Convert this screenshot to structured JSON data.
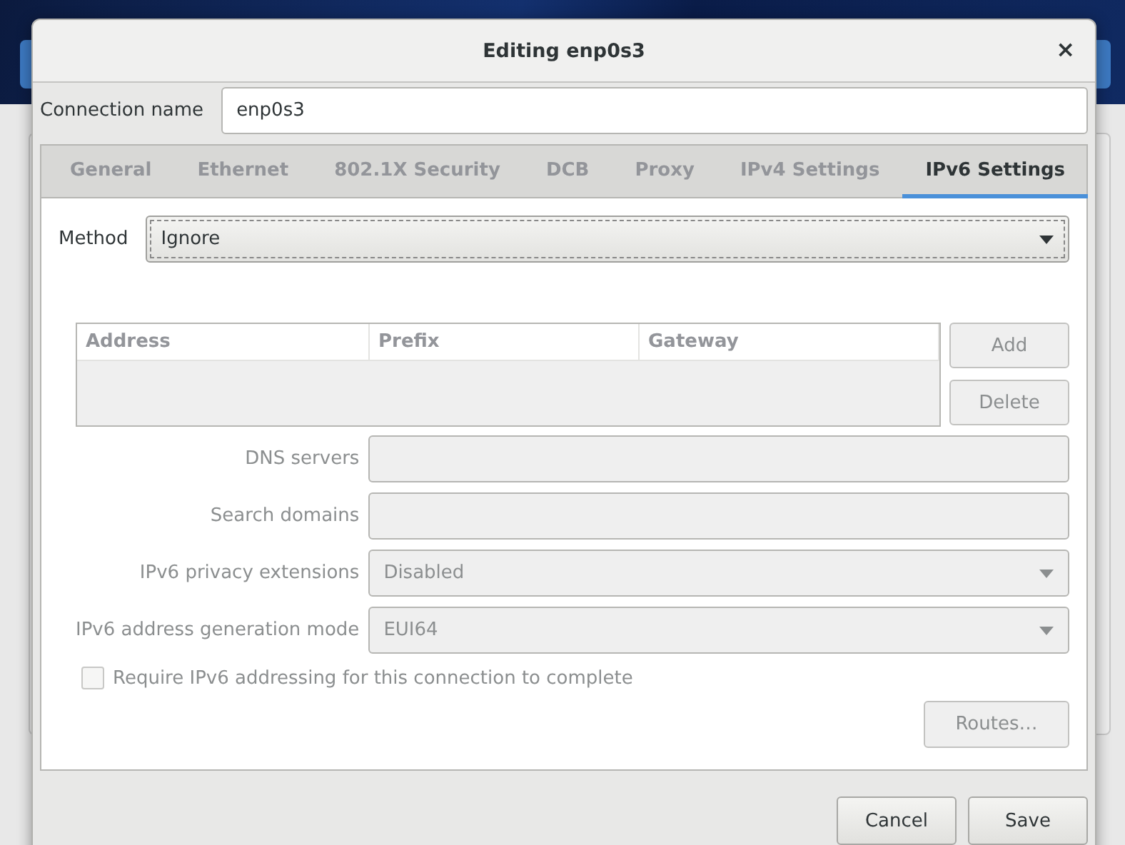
{
  "dialog": {
    "title": "Editing enp0s3",
    "close": "×",
    "connection_name": {
      "label": "Connection name",
      "value": "enp0s3"
    },
    "tabs": [
      {
        "label": "General",
        "selected": false
      },
      {
        "label": "Ethernet",
        "selected": false
      },
      {
        "label": "802.1X Security",
        "selected": false
      },
      {
        "label": "DCB",
        "selected": false
      },
      {
        "label": "Proxy",
        "selected": false
      },
      {
        "label": "IPv4 Settings",
        "selected": false
      },
      {
        "label": "IPv6 Settings",
        "selected": true
      }
    ],
    "method": {
      "label": "Method",
      "value": "Ignore"
    },
    "addresses": {
      "columns": [
        "Address",
        "Prefix",
        "Gateway"
      ],
      "disabled": true
    },
    "address_buttons": [
      {
        "label": "Add",
        "disabled": true
      },
      {
        "label": "Delete",
        "disabled": true
      }
    ],
    "fields": [
      {
        "kind": "entry",
        "label": "DNS servers",
        "disabled": true
      },
      {
        "kind": "entry",
        "label": "Search domains",
        "disabled": true
      },
      {
        "kind": "combo",
        "label": "IPv6 privacy extensions",
        "value": "Disabled",
        "disabled": true
      },
      {
        "kind": "combo",
        "label": "IPv6 address generation mode",
        "value": "EUI64",
        "disabled": true
      }
    ],
    "require_checkbox": {
      "label": "Require IPv6 addressing for this connection to complete",
      "checked": false,
      "disabled": true
    },
    "routes_button": {
      "label": "Routes…",
      "disabled": true
    },
    "buttons": [
      {
        "label": "Cancel"
      },
      {
        "label": "Save"
      }
    ]
  }
}
